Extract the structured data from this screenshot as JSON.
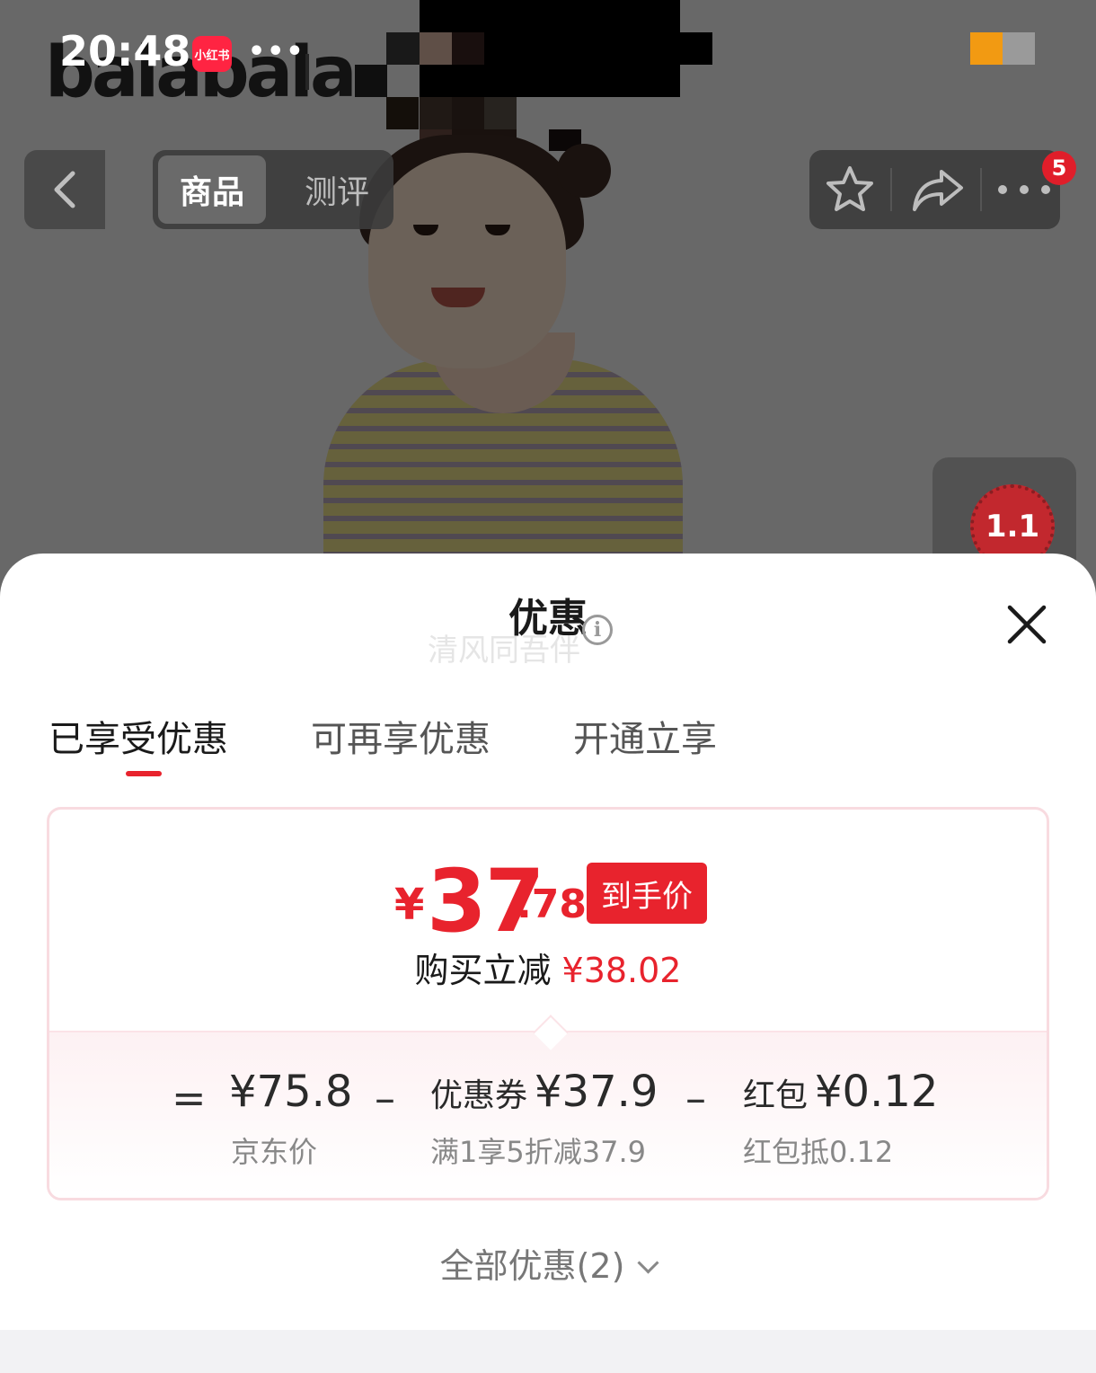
{
  "status_bar": {
    "time": "20:48",
    "app_badge": "小红书",
    "dots": "•••"
  },
  "background": {
    "brand_logo": "balabala"
  },
  "nav": {
    "tabs": [
      {
        "label": "商品",
        "active": true
      },
      {
        "label": "测评",
        "active": false
      }
    ],
    "badge_count": "5"
  },
  "float_widget": {
    "label": "1.1"
  },
  "sheet": {
    "title": "优惠",
    "info_glyph": "i",
    "watermark": "清风同吾伴",
    "tabs": [
      {
        "label": "已享受优惠"
      },
      {
        "label": "可再享优惠"
      },
      {
        "label": "开通立享"
      }
    ],
    "final_price": {
      "symbol": "¥",
      "integer": "37",
      "decimal": ".78",
      "tag": "到手价"
    },
    "savings": {
      "label": "购买立减",
      "amount": "¥38.02"
    },
    "breakdown": {
      "eq": "=",
      "minus": "–",
      "base": {
        "value": "¥75.8",
        "note": "京东价"
      },
      "coupon": {
        "label": "优惠券",
        "value": "¥37.9",
        "note": "满1享5折减37.9"
      },
      "redpacket": {
        "label": "红包",
        "value": "¥0.12",
        "note": "红包抵0.12"
      }
    },
    "all_offers": "全部优惠(2)"
  },
  "colors": {
    "accent": "#e8232d",
    "card_border": "#f8dbe0"
  }
}
